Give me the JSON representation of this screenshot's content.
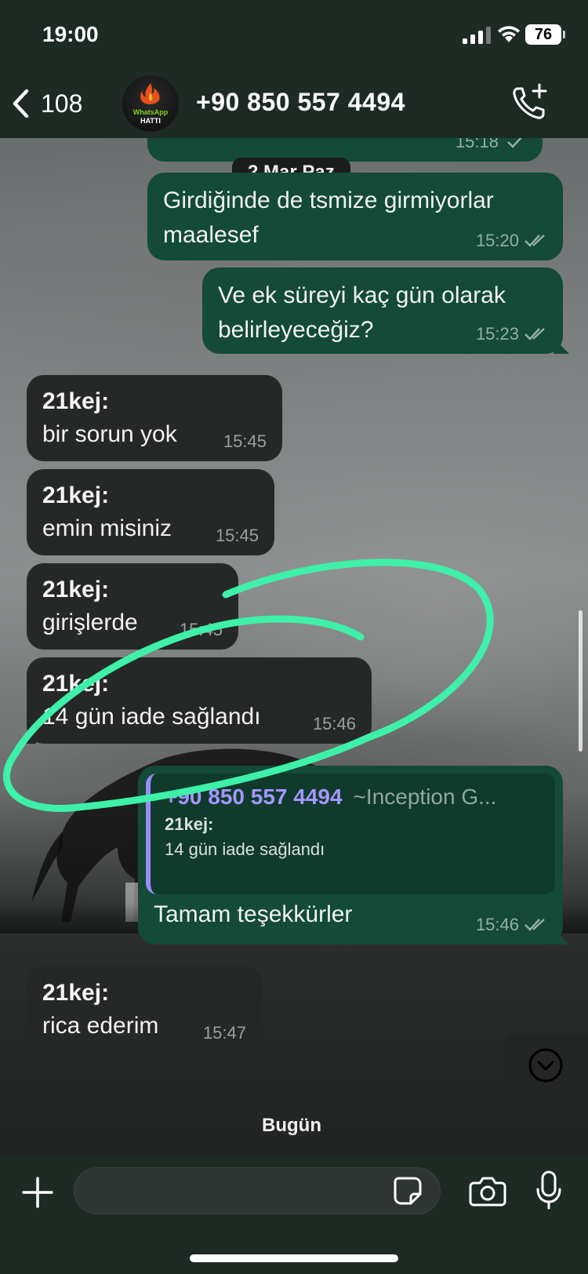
{
  "status_bar": {
    "time": "19:00",
    "battery": "76"
  },
  "header": {
    "back_count": "108",
    "avatar_text_line1": "WhatsApp",
    "avatar_text_line2": "HATTI",
    "contact_name": "+90 850 557 4494"
  },
  "chat": {
    "date_divider": "2 Mar Paz",
    "today_divider": "Bugün",
    "partial_top_time": "15:18",
    "messages": [
      {
        "dir": "out",
        "text_line1": "Girdiğinde de tsmize girmiyorlar",
        "text_line2": "maalesef",
        "time": "15:20"
      },
      {
        "dir": "out",
        "text_line1": "Ve ek süreyi kaç gün olarak",
        "text_line2": "belirleyeceğiz?",
        "time": "15:23"
      },
      {
        "dir": "in",
        "sender": "21kej:",
        "text": "bir sorun yok",
        "time": "15:45"
      },
      {
        "dir": "in",
        "sender": "21kej:",
        "text": "emin misiniz",
        "time": "15:45"
      },
      {
        "dir": "in",
        "sender": "21kej:",
        "text": "girişlerde",
        "time": "15:45"
      },
      {
        "dir": "in",
        "sender": "21kej:",
        "text": "14 gün iade sağlandı",
        "time": "15:46"
      },
      {
        "dir": "out",
        "reply": {
          "sender": "+90 850 557 4494",
          "group": "~Inception G...",
          "name": "21kej:",
          "text": "14 gün iade sağlandı"
        },
        "text": "Tamam teşekkürler",
        "time": "15:46"
      },
      {
        "dir": "in",
        "sender": "21kej:",
        "text": "rica ederim",
        "time": "15:47"
      }
    ]
  },
  "input": {
    "placeholder": ""
  },
  "colors": {
    "outgoing_bubble": "#134a38",
    "incoming_bubble": "#252827",
    "header_bg": "#1e2a24",
    "annotation_stroke": "#3ef0a8",
    "reply_accent": "#a596ff"
  },
  "icons": [
    "back-chevron-icon",
    "call-add-icon",
    "double-check-icon",
    "single-check-icon",
    "chevron-down-icon",
    "plus-icon",
    "sticker-icon",
    "camera-icon",
    "microphone-icon"
  ]
}
